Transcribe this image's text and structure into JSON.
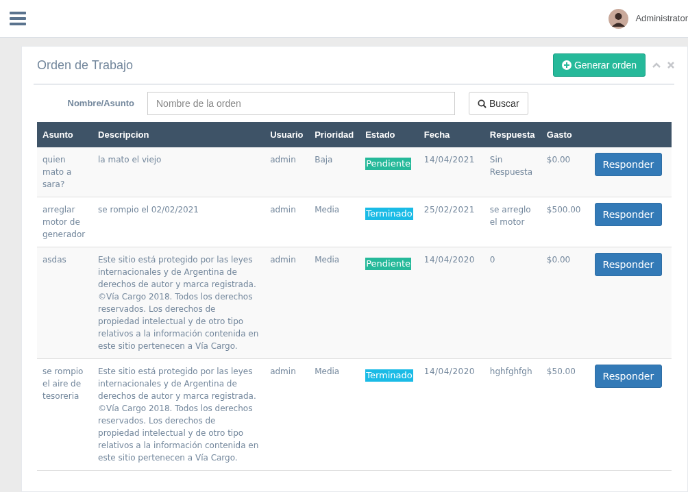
{
  "navbar": {
    "user": "Administrator"
  },
  "panel": {
    "title": "Orden de Trabajo",
    "add_button": "Generar orden"
  },
  "search": {
    "label": "Nombre/Asunto",
    "placeholder": "Nombre de la orden",
    "button": "Buscar"
  },
  "table": {
    "columns": [
      "Asunto",
      "Descripcion",
      "Usuario",
      "Prioridad",
      "Estado",
      "Fecha",
      "Respuesta",
      "Gasto"
    ],
    "rows": [
      {
        "asunto": "quien mato a sara?",
        "descripcion": "la mato el viejo",
        "usuario": "admin",
        "prioridad": "Baja",
        "estado": {
          "label": "Pendiente",
          "color": "#26b99a"
        },
        "fecha": "14/04/2021",
        "respuesta": "Sin Respuesta",
        "gasto": "$0.00",
        "action": "Responder"
      },
      {
        "asunto": "arreglar motor de generador",
        "descripcion": "se rompio el 02/02/2021",
        "usuario": "admin",
        "prioridad": "Media",
        "estado": {
          "label": "Terminado",
          "color": "#1abbe6"
        },
        "fecha": "25/02/2021",
        "respuesta": "se arreglo el motor",
        "gasto": "$500.00",
        "action": "Responder"
      },
      {
        "asunto": "asdas",
        "descripcion": "Este sitio está protegido por las leyes internacionales y de Argentina de derechos de autor y marca registrada. ©Vía Cargo 2018. Todos los derechos reservados. Los derechos de propiedad intelectual y de otro tipo relativos a la información contenida en este sitio pertenecen a Vía Cargo.",
        "usuario": "admin",
        "prioridad": "Media",
        "estado": {
          "label": "Pendiente",
          "color": "#26b99a"
        },
        "fecha": "14/04/2020",
        "respuesta": "0",
        "gasto": "$0.00",
        "action": "Responder"
      },
      {
        "asunto": "se rompio el aire de tesoreria",
        "descripcion": "Este sitio está protegido por las leyes internacionales y de Argentina de derechos de autor y marca registrada. ©Vía Cargo 2018. Todos los derechos reservados. Los derechos de propiedad intelectual y de otro tipo relativos a la información contenida en este sitio pertenecen a Vía Cargo.",
        "usuario": "admin",
        "prioridad": "Media",
        "estado": {
          "label": "Terminado",
          "color": "#1abbe6"
        },
        "fecha": "14/04/2020",
        "respuesta": "hghfghfgh",
        "gasto": "$50.00",
        "action": "Responder"
      }
    ]
  }
}
